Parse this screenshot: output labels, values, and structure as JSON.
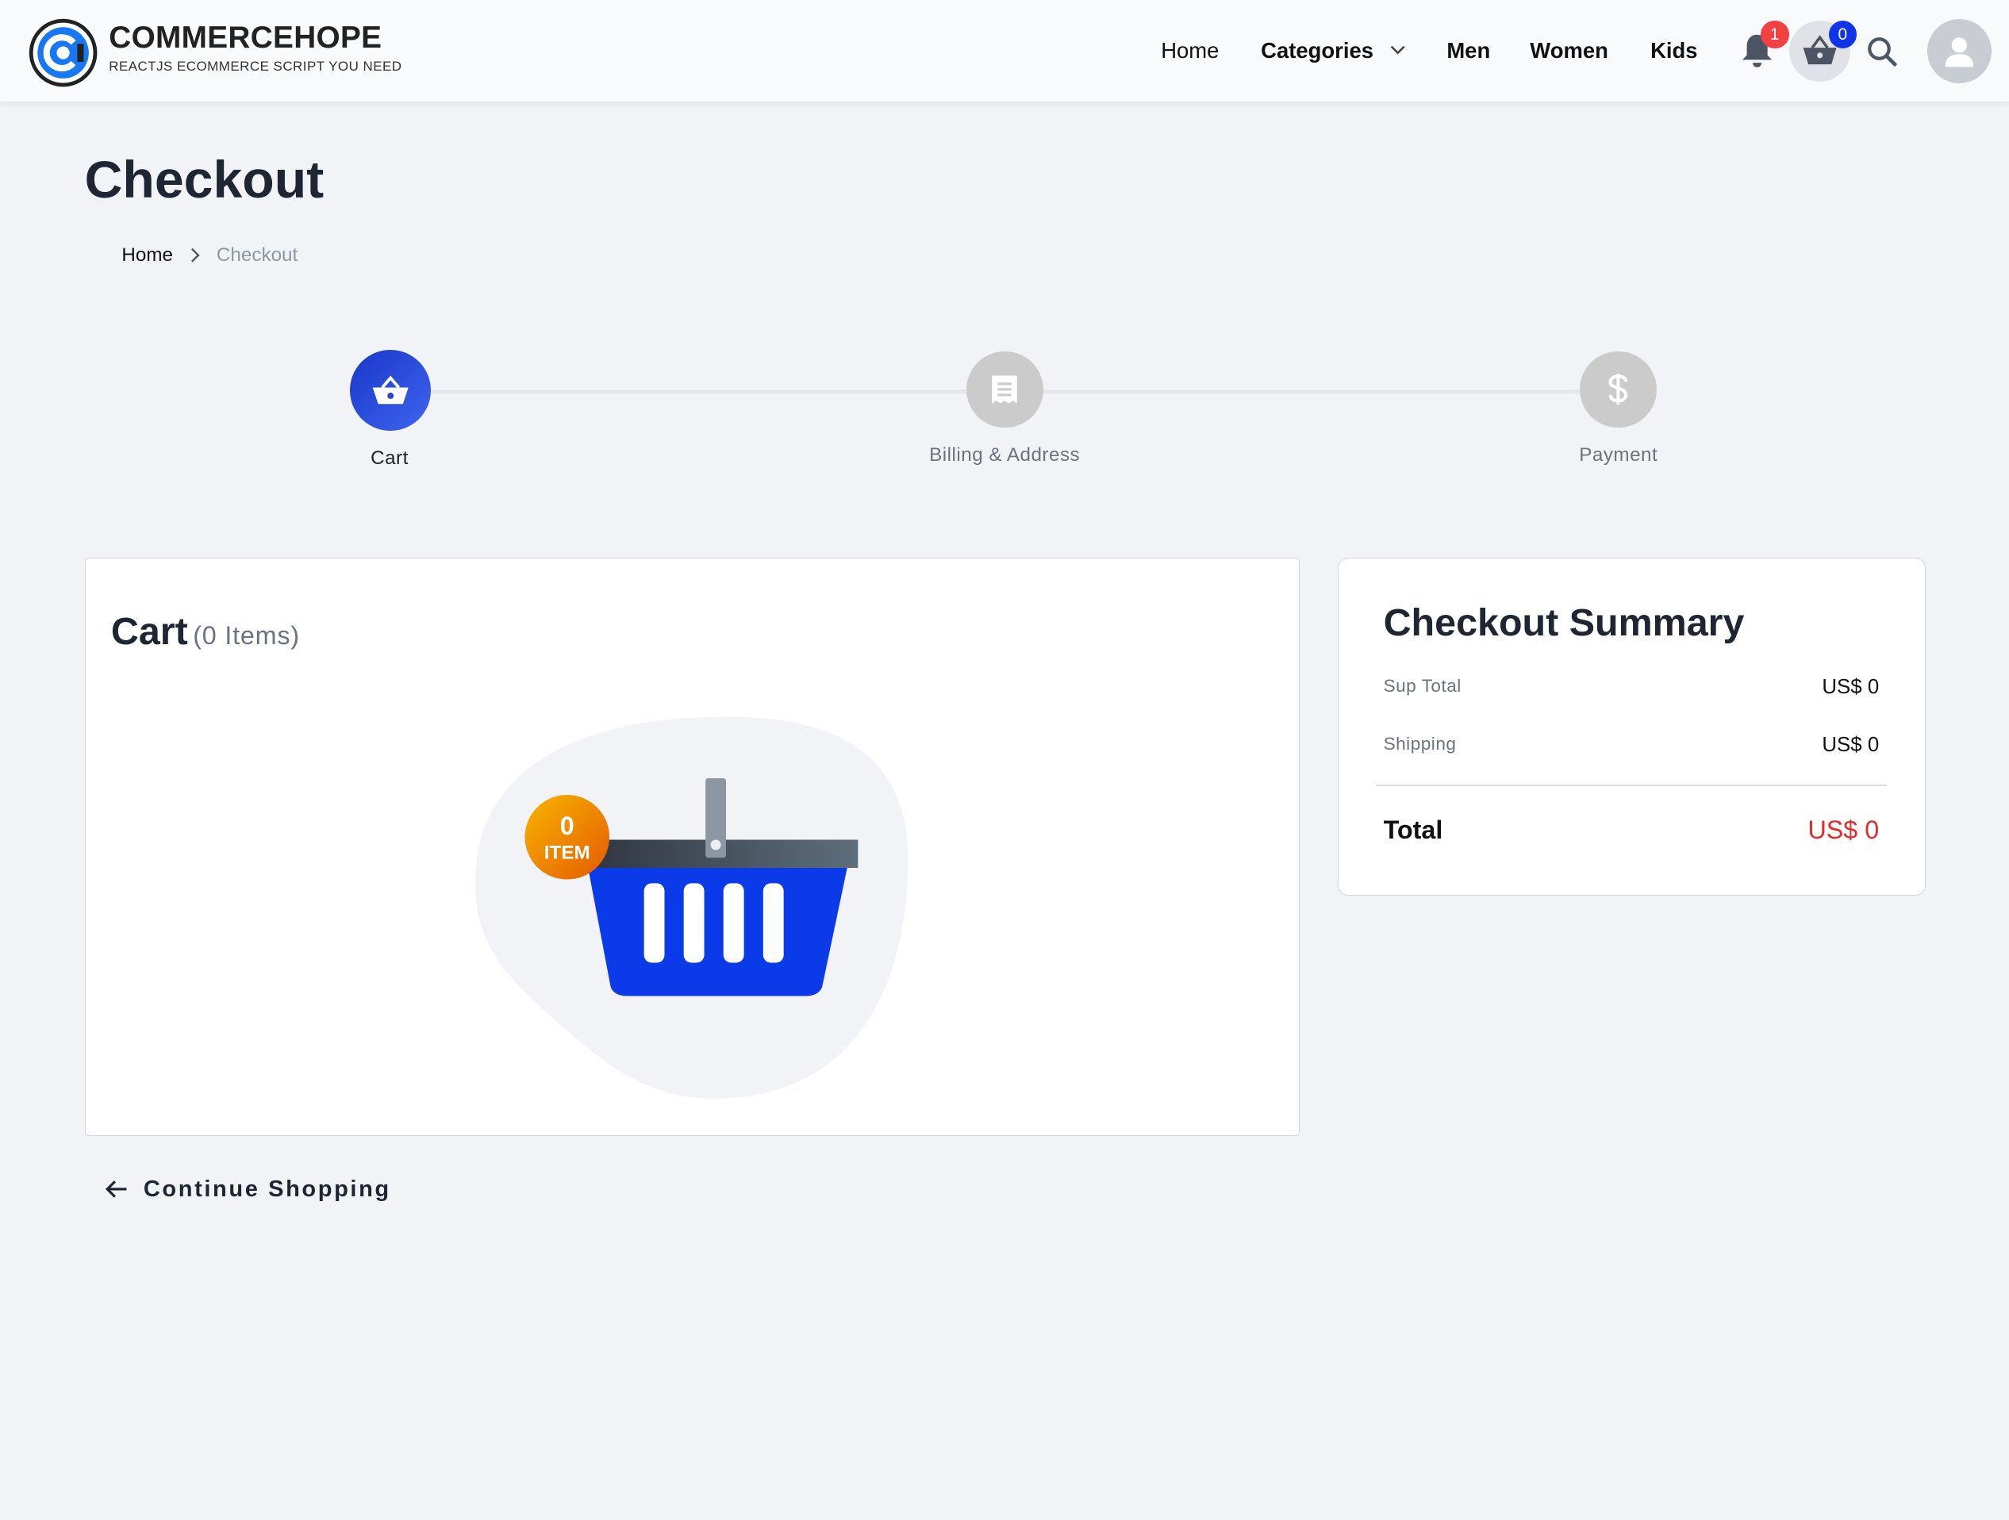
{
  "header": {
    "brand": "COMMERCEHOPE",
    "tagline": "REACTJS ECOMMERCE SCRIPT YOU NEED",
    "nav": {
      "home": "Home",
      "categories": "Categories",
      "men": "Men",
      "women": "Women",
      "kids": "Kids"
    },
    "notification_count": "1",
    "cart_count": "0"
  },
  "page": {
    "title": "Checkout",
    "breadcrumb": {
      "home": "Home",
      "current": "Checkout"
    }
  },
  "stepper": {
    "steps": [
      {
        "label": "Cart",
        "icon": "basket-icon",
        "state": "active"
      },
      {
        "label": "Billing & Address",
        "icon": "receipt-icon",
        "state": "inactive"
      },
      {
        "label": "Payment",
        "icon": "dollar-icon",
        "state": "inactive"
      }
    ]
  },
  "cart": {
    "title": "Cart",
    "count_label": "(0 Items)",
    "empty_badge_count": "0",
    "empty_badge_label": "ITEM"
  },
  "summary": {
    "title": "Checkout Summary",
    "subtotal_label": "Sup Total",
    "subtotal_value": "US$ 0",
    "shipping_label": "Shipping",
    "shipping_value": "US$ 0",
    "total_label": "Total",
    "total_value": "US$ 0"
  },
  "continue_label": "Continue Shopping",
  "colors": {
    "accent": "#1035e8",
    "total": "#e32c2c",
    "badge_notification": "#f44040",
    "background": "#f2f3f7"
  }
}
